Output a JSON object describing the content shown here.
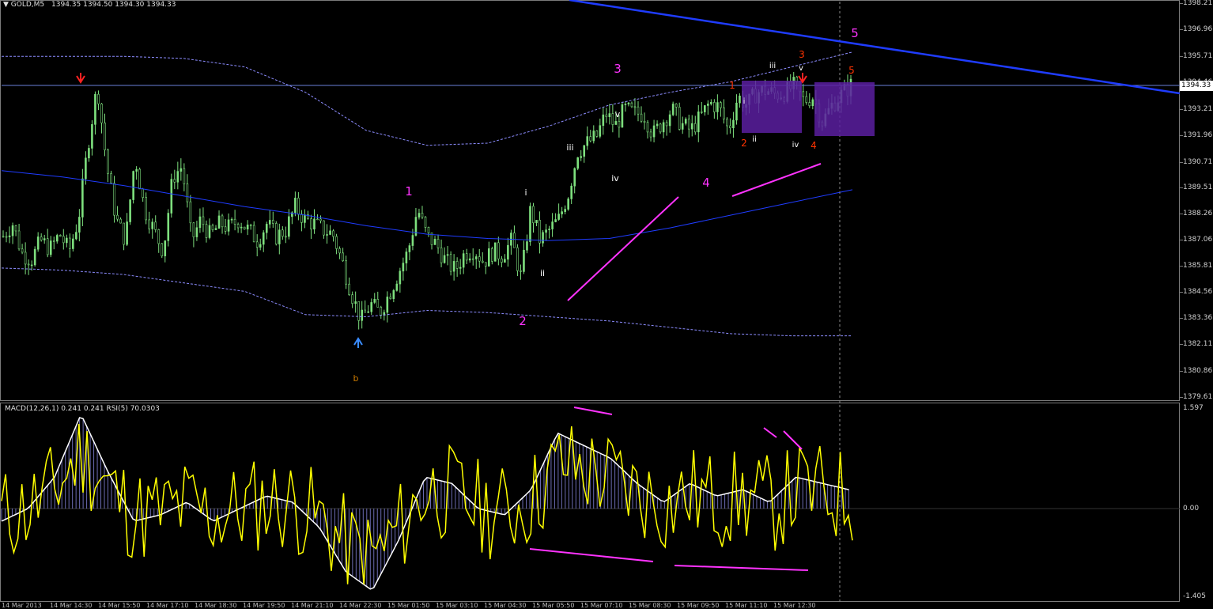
{
  "window": {
    "symbol_header": "GOLD,M5",
    "ohlc": "1394.35 1394.50 1394.30 1394.33",
    "current_price": "1394.33"
  },
  "indicator": {
    "header": "MACD(12,26,1) 0.241 0.241 RSI(5) 70.0303",
    "y_labels": [
      "1.597",
      "0.00",
      "-1.405"
    ]
  },
  "price_axis_labels": [
    "1398.21",
    "1396.96",
    "1395.71",
    "1394.46",
    "1393.21",
    "1391.96",
    "1390.71",
    "1389.51",
    "1388.26",
    "1387.06",
    "1385.81",
    "1384.56",
    "1383.36",
    "1382.11",
    "1380.86",
    "1379.61"
  ],
  "time_axis_labels": [
    "14 Mar 2013",
    "14 Mar 14:30",
    "14 Mar 15:50",
    "14 Mar 17:10",
    "14 Mar 18:30",
    "14 Mar 19:50",
    "14 Mar 21:10",
    "14 Mar 22:30",
    "15 Mar 01:50",
    "15 Mar 03:10",
    "15 Mar 04:30",
    "15 Mar 05:50",
    "15 Mar 07:10",
    "15 Mar 08:30",
    "15 Mar 09:50",
    "15 Mar 11:10",
    "15 Mar 12:30"
  ],
  "wave_labels": [
    {
      "text": "1",
      "color": "#ff33ff"
    },
    {
      "text": "2",
      "color": "#ff33ff"
    },
    {
      "text": "3",
      "color": "#ff33ff"
    },
    {
      "text": "4",
      "color": "#ff33ff"
    },
    {
      "text": "5",
      "color": "#ff33ff"
    },
    {
      "text": "i",
      "color": "#ffffff"
    },
    {
      "text": "ii",
      "color": "#ffffff"
    },
    {
      "text": "iii",
      "color": "#ffffff"
    },
    {
      "text": "iv",
      "color": "#ffffff"
    },
    {
      "text": "v",
      "color": "#ffffff"
    },
    {
      "text": "1",
      "color": "#ff3300"
    },
    {
      "text": "2",
      "color": "#ff3300"
    },
    {
      "text": "3",
      "color": "#ff3300"
    },
    {
      "text": "4",
      "color": "#ff3300"
    },
    {
      "text": "5",
      "color": "#ff3300"
    },
    {
      "text": "i",
      "color": "#ffffff"
    },
    {
      "text": "ii",
      "color": "#ffffff"
    },
    {
      "text": "iii",
      "color": "#ffffff"
    },
    {
      "text": "iv",
      "color": "#ffffff"
    },
    {
      "text": "v",
      "color": "#ffffff"
    },
    {
      "text": "b",
      "color": "#cc7a00"
    }
  ],
  "colors": {
    "background": "#000000",
    "bullish_candle": "#7ee07e",
    "envelope": "#8c8cff",
    "moving_average": "#1f3cff",
    "trend_line": "#1f3cff",
    "annotation_line": "#ff33ff",
    "rect_zone": "#5a1fa0",
    "rsi": "#ffff00",
    "macd_signal": "#ffffff",
    "macd_hist": "#9a9aff"
  },
  "chart_data": {
    "type": "candlestick",
    "symbol": "GOLD",
    "timeframe": "M5",
    "ylim": [
      1379.61,
      1398.21
    ],
    "price_path": [
      1387.2,
      1387.8,
      1386.4,
      1386.1,
      1387.0,
      1386.6,
      1387.3,
      1386.5,
      1388.0,
      1391.5,
      1394.33,
      1390.5,
      1388.0,
      1387.0,
      1391.0,
      1388.5,
      1387.5,
      1386.5,
      1390.0,
      1390.5,
      1387.0,
      1388.0,
      1387.2,
      1387.8,
      1387.6,
      1388.0,
      1387.5,
      1387.0,
      1387.8,
      1387.2,
      1387.5,
      1388.6,
      1388.0,
      1387.8,
      1387.5,
      1387.3,
      1386.0,
      1384.5,
      1383.2,
      1384.0,
      1383.6,
      1384.5,
      1385.5,
      1386.5,
      1388.5,
      1387.2,
      1386.8,
      1386.0,
      1385.6,
      1386.4,
      1386.6,
      1386.0,
      1386.5,
      1386.3,
      1387.0,
      1385.2,
      1388.5,
      1387.0,
      1387.5,
      1388.0,
      1389.2,
      1391.2,
      1391.6,
      1391.9,
      1393.0,
      1392.4,
      1393.2,
      1393.0,
      1393.0,
      1392.0,
      1392.6,
      1393.2,
      1392.5,
      1392.2,
      1392.8,
      1393.5,
      1393.3,
      1392.2,
      1393.8,
      1393.4,
      1394.0,
      1394.1,
      1393.9,
      1394.0,
      1394.3,
      1393.6,
      1393.8,
      1392.6,
      1393.4,
      1393.9,
      1394.33
    ],
    "moving_average": [
      1390.3,
      1390.0,
      1389.6,
      1389.1,
      1388.6,
      1388.2,
      1387.7,
      1387.3,
      1387.1,
      1387.0,
      1387.1,
      1387.6,
      1388.2,
      1388.8,
      1389.4
    ],
    "envelope_upper": [
      1395.7,
      1395.7,
      1395.7,
      1395.6,
      1395.2,
      1394.0,
      1392.2,
      1391.5,
      1391.6,
      1392.4,
      1393.4,
      1394.0,
      1394.5,
      1395.2,
      1395.9
    ],
    "envelope_lower": [
      1385.7,
      1385.6,
      1385.4,
      1385.0,
      1384.6,
      1383.5,
      1383.4,
      1383.7,
      1383.6,
      1383.4,
      1383.2,
      1382.9,
      1382.6,
      1382.5,
      1382.5
    ],
    "indicator": {
      "macd": {
        "fast": 12,
        "slow": 26,
        "signal": 1,
        "value": 0.241,
        "signal_value": 0.241
      },
      "rsi": {
        "period": 5,
        "value": 70.0303
      },
      "ylim": [
        -1.405,
        1.597
      ]
    }
  }
}
